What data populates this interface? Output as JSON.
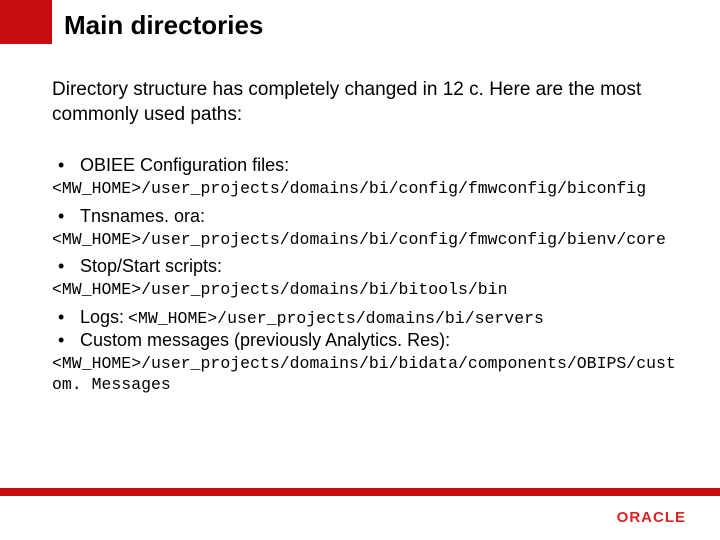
{
  "title": "Main directories",
  "intro": "Directory structure has completely changed in 12 c. Here are the most commonly used paths:",
  "items": [
    {
      "label": "OBIEE Configuration files:",
      "path": "<MW_HOME>/user_projects/domains/bi/config/fmwconfig/biconfig",
      "inline": false
    },
    {
      "label": "Tnsnames. ora:",
      "path": "<MW_HOME>/user_projects/domains/bi/config/fmwconfig/bienv/core",
      "inline": false
    },
    {
      "label": "Stop/Start scripts:",
      "path": "<MW_HOME>/user_projects/domains/bi/bitools/bin",
      "inline": false
    },
    {
      "label": "Logs:",
      "path": "<MW_HOME>/user_projects/domains/bi/servers",
      "inline": true
    },
    {
      "label": "Custom messages (previously Analytics. Res):",
      "path": "<MW_HOME>/user_projects/domains/bi/bidata/components/OBIPS/cust om. Messages",
      "inline": false
    }
  ],
  "logo_text": "ORACLE",
  "colors": {
    "brand_red": "#c60c0c"
  }
}
